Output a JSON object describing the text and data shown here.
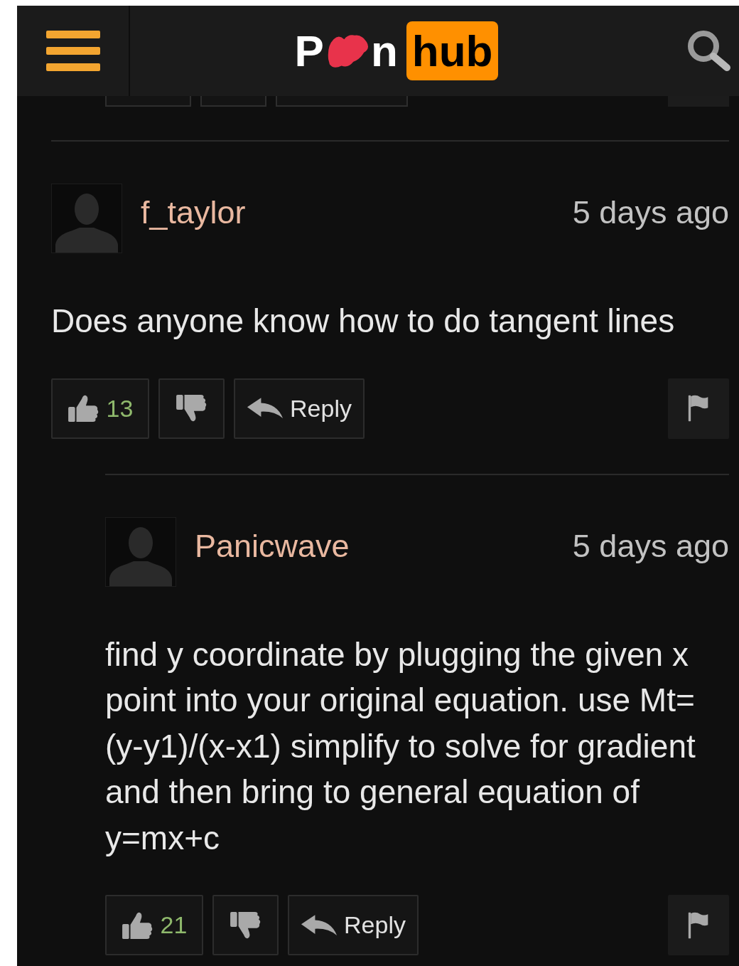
{
  "header": {
    "logo": {
      "start": "P",
      "end": "n",
      "badge": "hub"
    }
  },
  "previous_comment_actions": [
    {
      "kind": "like"
    },
    {
      "kind": "dislike"
    },
    {
      "kind": "reply"
    },
    {
      "kind": "flag"
    }
  ],
  "comments": [
    {
      "username": "f_taylor",
      "time": "5 days ago",
      "body": "Does anyone know how to do tangent lines",
      "likes": "13",
      "reply": "Reply",
      "children": [
        {
          "username": "Panicwave",
          "time": "5 days ago",
          "body": "find y coordinate by plugging the given x point into your original equation. use Mt= (y-y1)/(x-x1) simplify to solve for gradient and then bring to general equation of y=mx+c",
          "likes": "21",
          "reply": "Reply"
        }
      ]
    }
  ]
}
